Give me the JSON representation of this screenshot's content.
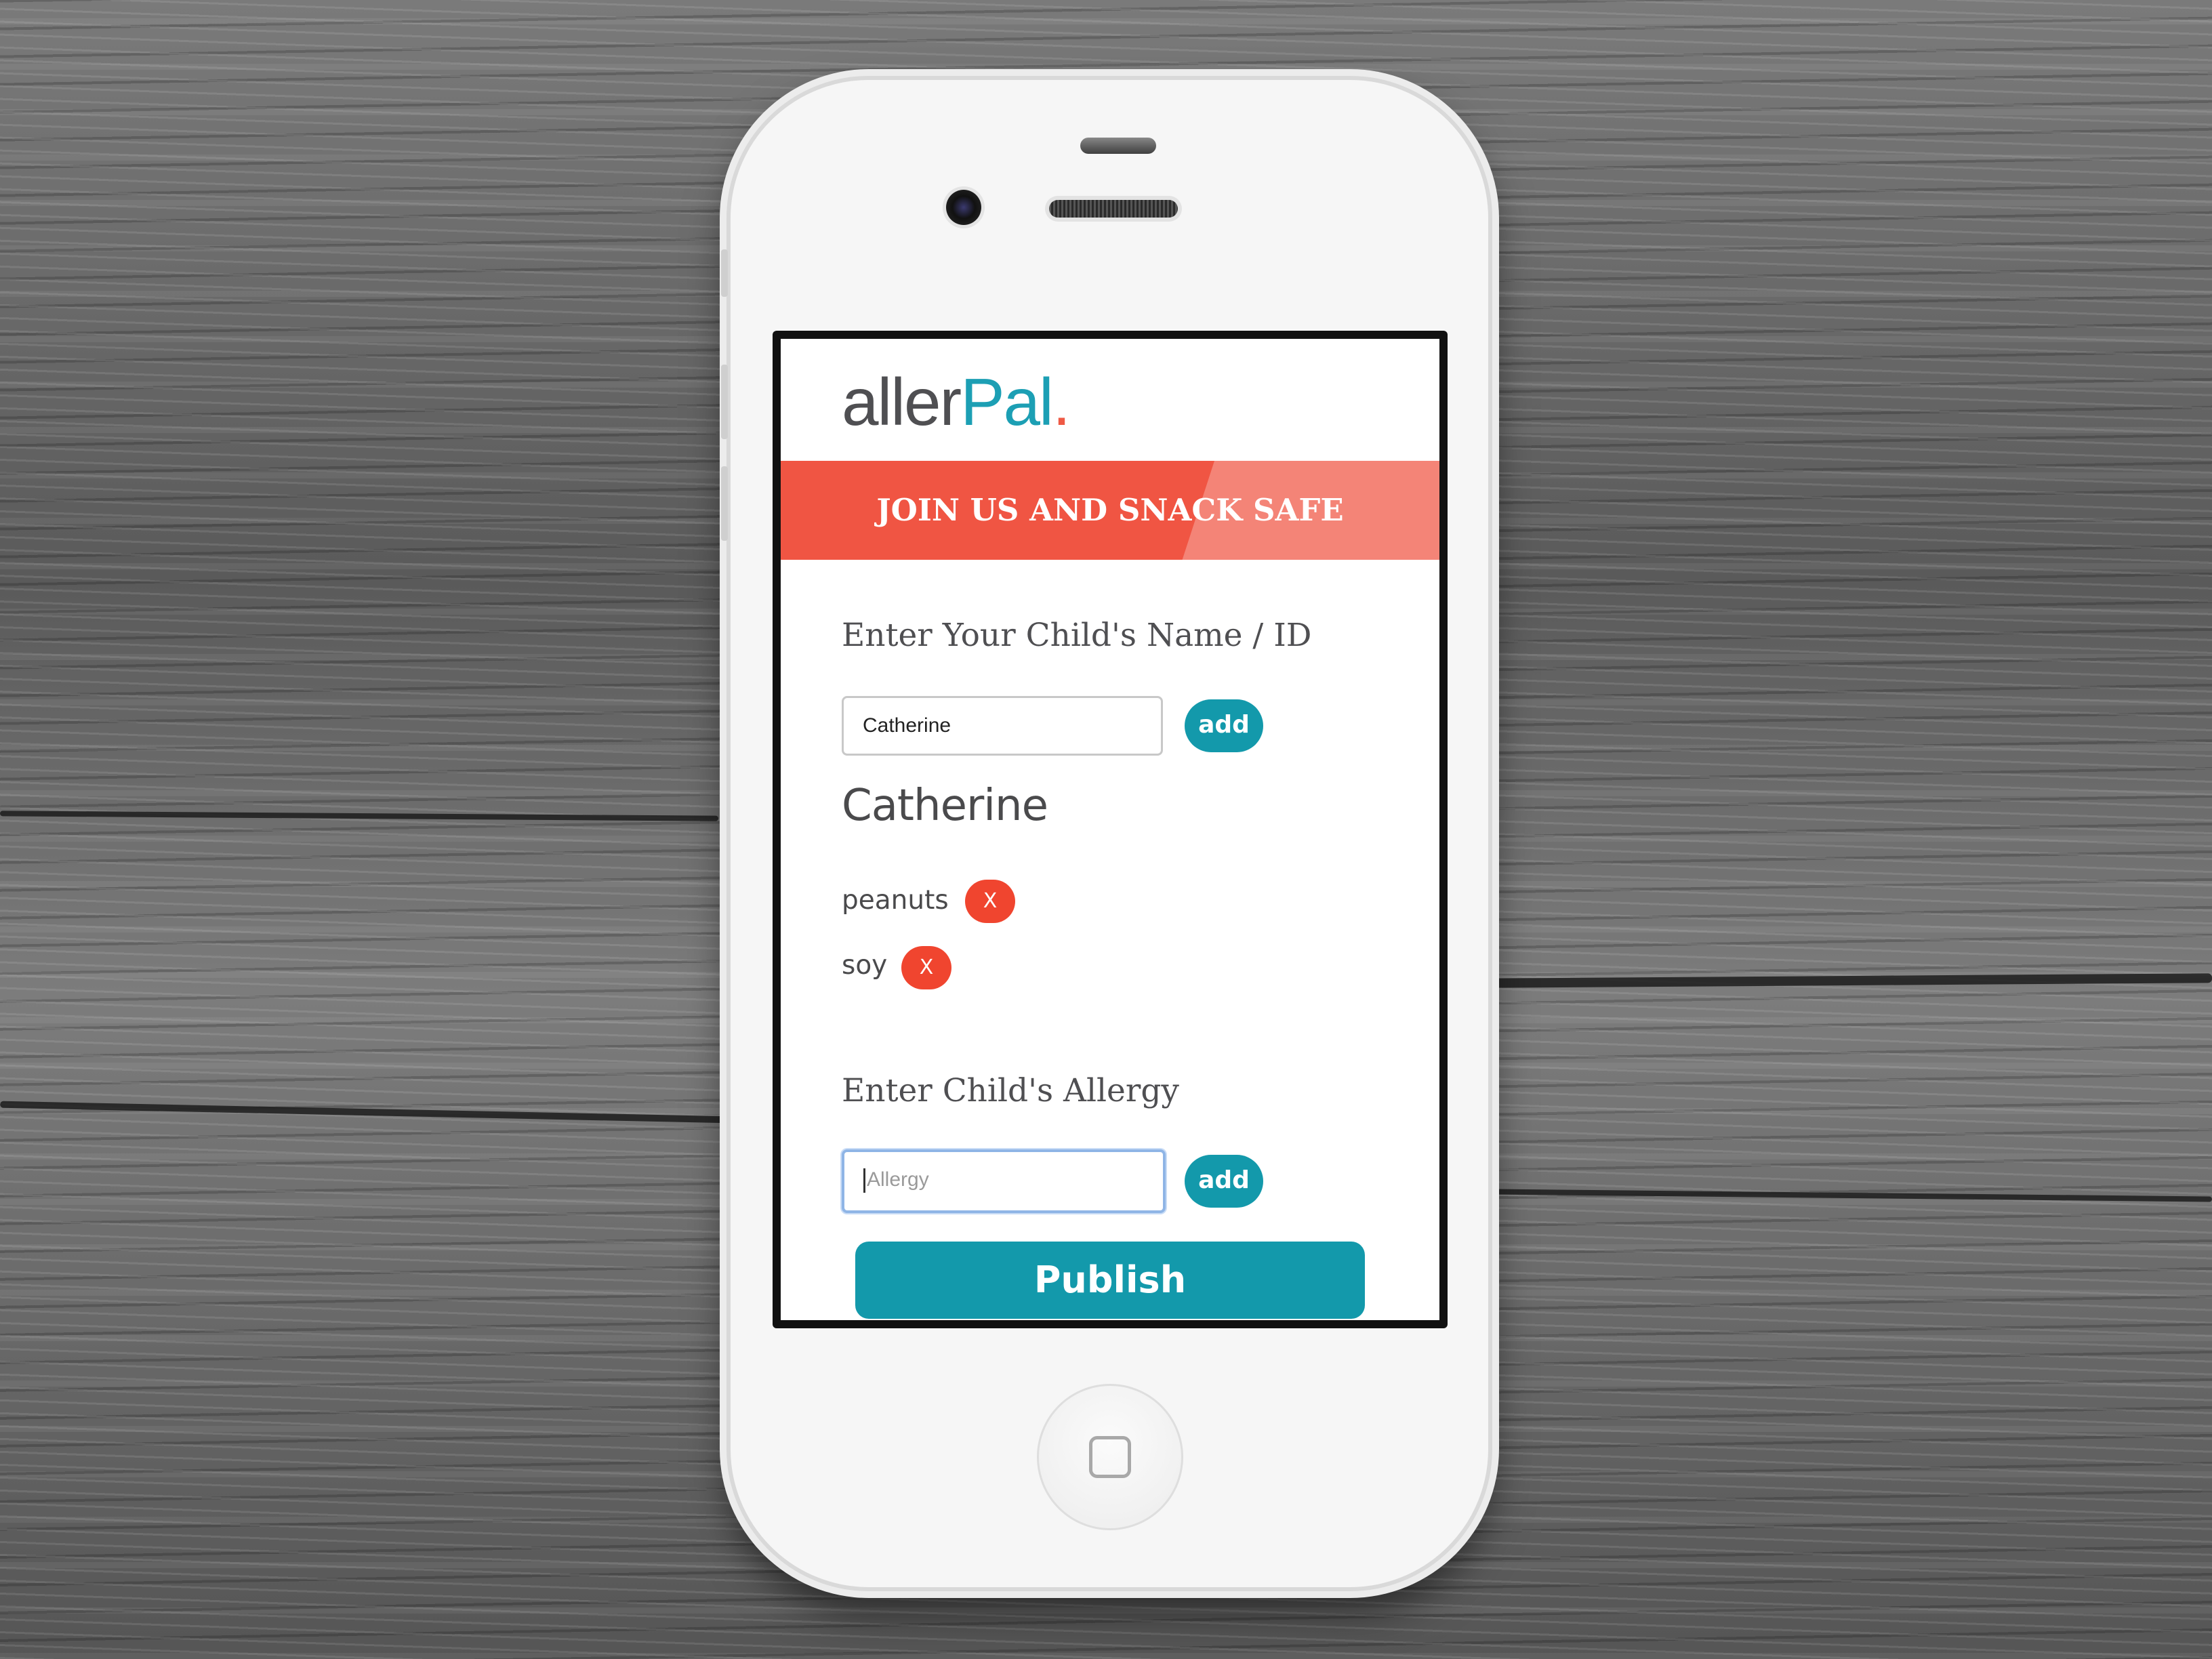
{
  "app": {
    "logo": {
      "part1": "aller",
      "part2": "Pal",
      "dot": "."
    },
    "banner": "JOIN US AND SNACK SAFE",
    "name_section": {
      "label": "Enter Your Child's Name / ID",
      "input_value": "Catherine",
      "add_label": "add"
    },
    "child_name": "Catherine",
    "allergies": [
      {
        "name": "peanuts",
        "remove_label": "X"
      },
      {
        "name": "soy",
        "remove_label": "X"
      }
    ],
    "allergy_section": {
      "label": "Enter Child's Allergy",
      "input_placeholder": "Allergy",
      "add_label": "add"
    },
    "publish_label": "Publish"
  },
  "colors": {
    "brand_teal": "#1399ab",
    "banner_red": "#f05543",
    "remove_red": "#f0452f",
    "text_dark": "#4a4a4c"
  },
  "icons": {
    "home_button": "home-square-icon"
  }
}
